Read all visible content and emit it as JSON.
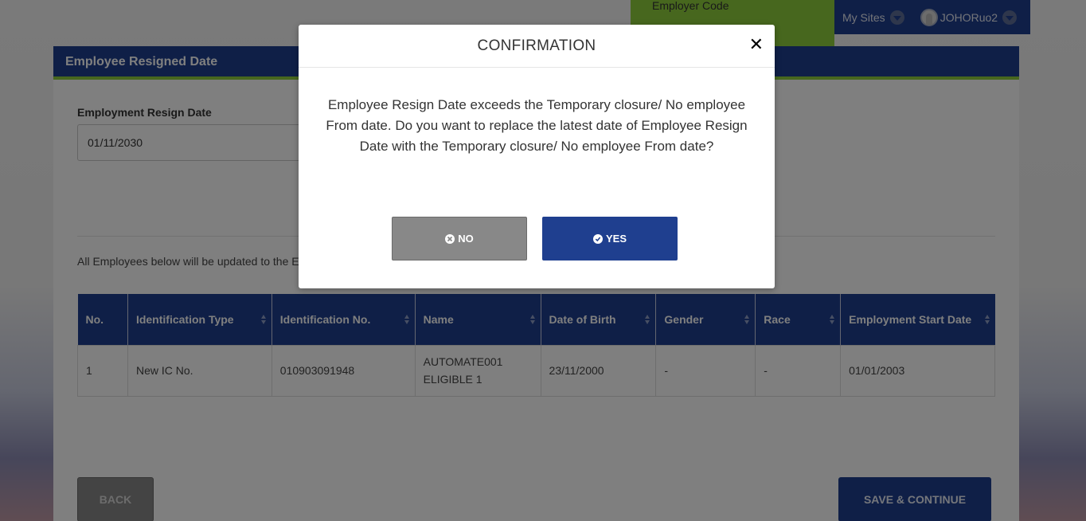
{
  "header": {
    "employer_code_label": "Employer Code",
    "my_sites_label": "My Sites",
    "user_name": "JOHORuo2"
  },
  "panel": {
    "title": "Employee Resigned Date",
    "field_label": "Employment Resign Date",
    "resign_date_value": "01/11/2030",
    "info_text": "All Employees below will be updated to the E"
  },
  "table": {
    "headers": [
      "No.",
      "Identification Type",
      "Identification No.",
      "Name",
      "Date of Birth",
      "Gender",
      "Race",
      "Employment Start Date"
    ],
    "rows": [
      {
        "no": "1",
        "id_type": "New IC No.",
        "id_no": "010903091948",
        "name": "AUTOMATE001 ELIGIBLE 1",
        "dob": "23/11/2000",
        "gender": "-",
        "race": "-",
        "start_date": "01/01/2003"
      }
    ]
  },
  "actions": {
    "back_label": "BACK",
    "save_label": "SAVE & CONTINUE"
  },
  "modal": {
    "title": "CONFIRMATION",
    "message": "Employee Resign Date exceeds the Temporary closure/ No employee From date. Do you want to replace the latest date of Employee Resign Date with the Temporary closure/ No employee From date?",
    "no_label": "NO",
    "yes_label": "YES",
    "close_icon": "close-icon",
    "no_icon": "times-circle-icon",
    "yes_icon": "check-circle-icon"
  },
  "colors": {
    "primary": "#1f3f8f",
    "accent": "#8fcf3c",
    "secondary_button": "#888888"
  }
}
